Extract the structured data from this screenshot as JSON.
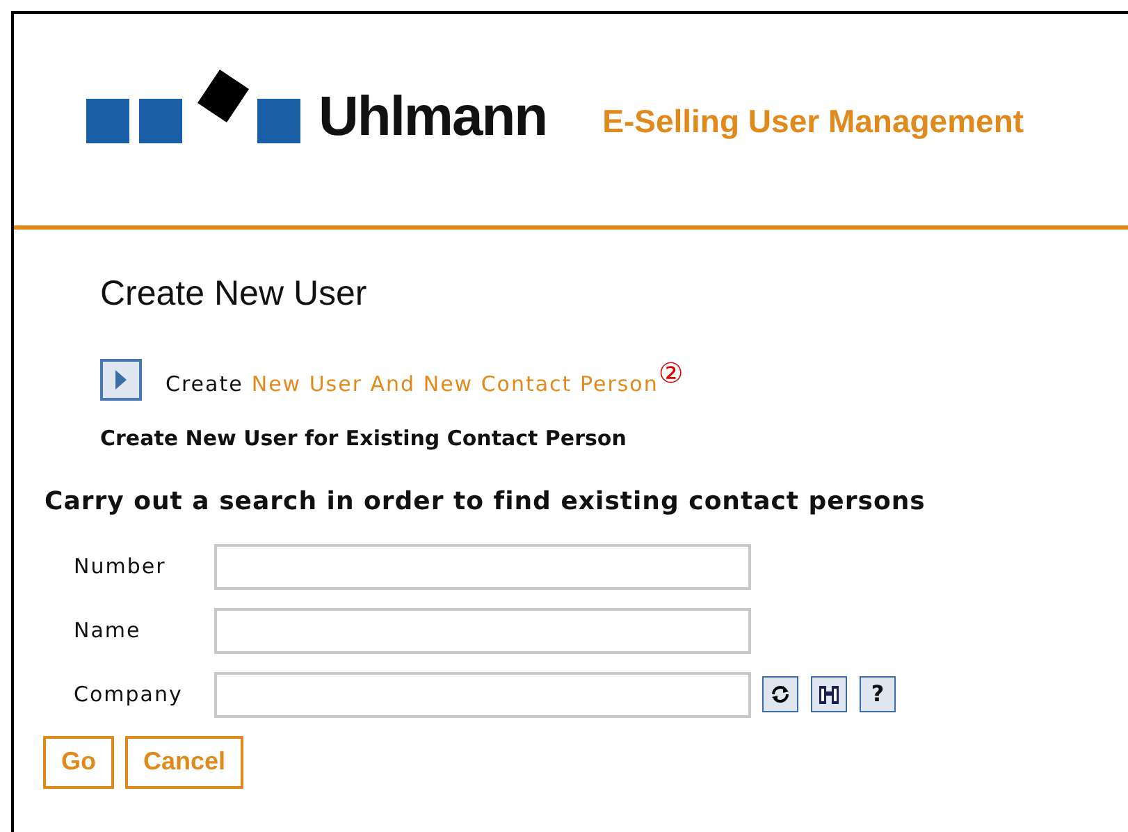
{
  "header": {
    "logo_text": "Uhlmann",
    "title": "E-Selling User Management"
  },
  "page_title": "Create New User",
  "create_link": {
    "prefix": "Create",
    "link": "New User And New Contact Person",
    "marker": "②"
  },
  "existing_heading": "Create New User for Existing Contact Person",
  "search_heading": "Carry out a search in order to find existing contact persons",
  "fields": [
    {
      "label": "Number",
      "tools": false
    },
    {
      "label": "Name",
      "tools": false
    },
    {
      "label": "Company",
      "tools": true
    }
  ],
  "help_glyph": "?",
  "buttons": [
    "Go",
    "Cancel"
  ]
}
